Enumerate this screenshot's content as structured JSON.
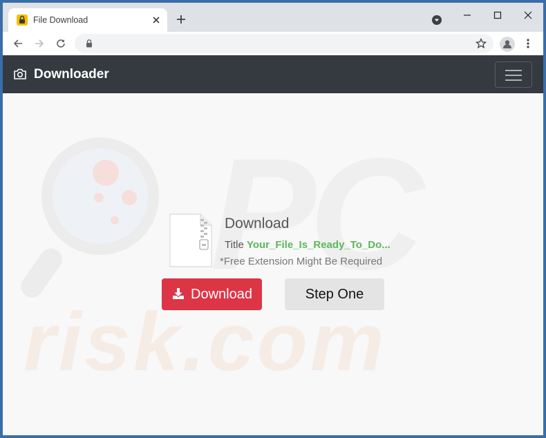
{
  "browser": {
    "tab": {
      "title": "File Download",
      "favicon": "lock-icon"
    },
    "toolbar": {
      "url": ""
    }
  },
  "navbar": {
    "brand": "Downloader",
    "brand_icon": "camera-icon",
    "toggle_icon": "hamburger-menu-icon"
  },
  "main": {
    "heading": "Download",
    "title_label": "Title",
    "file_title": "Your_File_Is_Ready_To_Do...",
    "note": "*Free Extension Might Be Required",
    "download_button": "Download",
    "step_button": "Step One"
  },
  "watermark": {
    "top": "PC",
    "bottom": "risk.com"
  },
  "colors": {
    "navbar_bg": "#343a40",
    "download_button_bg": "#dc3545",
    "file_title_color": "#5cb85c",
    "step_button_bg": "#e4e4e4"
  }
}
